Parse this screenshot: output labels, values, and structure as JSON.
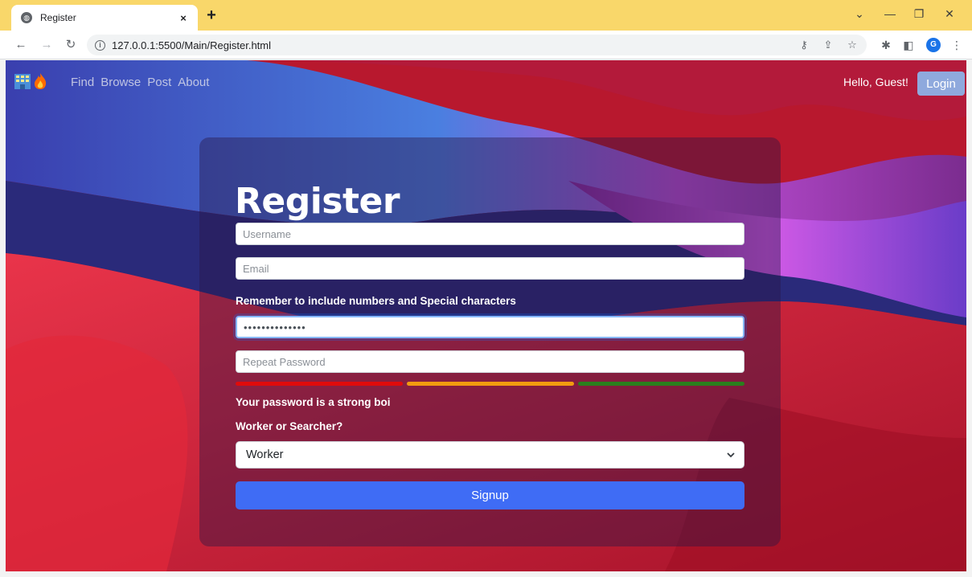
{
  "browser": {
    "tab_title": "Register",
    "tab_close": "×",
    "new_tab": "+",
    "url": "127.0.0.1:5500/Main/Register.html",
    "profile_initial": "G"
  },
  "nav": {
    "links": [
      "Find",
      "Browse",
      "Post",
      "About"
    ],
    "greeting": "Hello, Guest!",
    "login_label": "Login"
  },
  "form": {
    "title": "Register",
    "username_placeholder": "Username",
    "email_placeholder": "Email",
    "password_hint": "Remember to include numbers and Special characters",
    "password_value": "••••••••••••••",
    "repeat_placeholder": "Repeat Password",
    "strength_text": "Your password is a strong boi",
    "role_label": "Worker or Searcher?",
    "role_selected": "Worker",
    "signup_label": "Signup"
  },
  "colors": {
    "strength_weak": "#e00b0b",
    "strength_medium": "#f29c0f",
    "strength_strong": "#2a7f1d",
    "signup": "#3f6cf5"
  },
  "icons": [
    "globe-icon",
    "building-icon",
    "flame-icon",
    "info-icon",
    "key-icon",
    "share-icon",
    "star-icon",
    "puzzle-icon",
    "sidebar-icon",
    "chevron-down-icon"
  ]
}
